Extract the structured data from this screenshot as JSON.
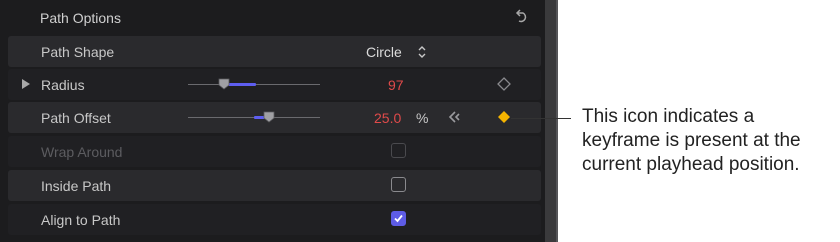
{
  "header": {
    "title": "Path Options",
    "reset_icon": "reset-arrow-icon"
  },
  "rows": {
    "path_shape": {
      "label": "Path Shape",
      "value": "Circle"
    },
    "radius": {
      "label": "Radius",
      "value": "97",
      "slider_fraction": 0.27
    },
    "path_offset": {
      "label": "Path Offset",
      "value": "25.0",
      "unit": "%",
      "slider_fraction": 0.6
    },
    "wrap_around": {
      "label": "Wrap Around",
      "checked": false,
      "enabled": false
    },
    "inside_path": {
      "label": "Inside Path",
      "checked": false,
      "enabled": true
    },
    "align_to_path": {
      "label": "Align to Path",
      "checked": true,
      "enabled": true
    }
  },
  "callout": {
    "line1": "This icon indicates a",
    "line2": "keyframe is present at the",
    "line3": "current playhead position."
  },
  "colors": {
    "accent": "#5e5ce6",
    "value_red": "#e04a4a",
    "keyframe_yellow": "#f5b400"
  }
}
